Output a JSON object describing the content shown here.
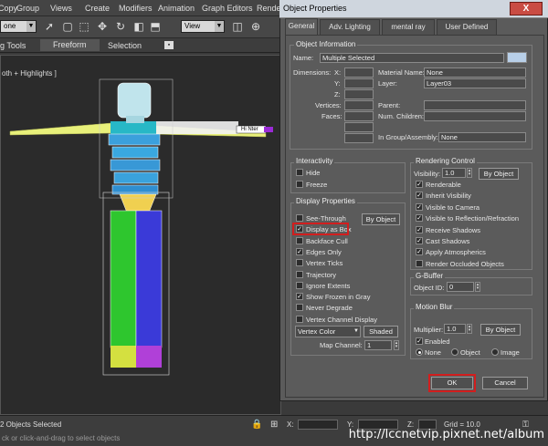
{
  "menubar": {
    "items": [
      "Copy",
      "Group",
      "Views",
      "Create",
      "Modifiers",
      "Animation",
      "Graph Editors",
      "Rende"
    ]
  },
  "toolbar": {
    "selection_filter": "one",
    "reference_coord": "View"
  },
  "ribbon": {
    "tabs": [
      "g Tools",
      "Freeform",
      "Selection"
    ]
  },
  "viewport": {
    "label": "oth + Highlights ]",
    "character_tag": "Hi Nter"
  },
  "status": {
    "selected": "2 Objects Selected",
    "hint": "ck or click-and-drag to select objects",
    "x_label": "X:",
    "y_label": "Y:",
    "z_label": "Z:",
    "grid": "Grid = 10.0"
  },
  "dialog": {
    "title": "Object Properties",
    "close": "X",
    "tabs": [
      "General",
      "Adv. Lighting",
      "mental ray",
      "User Defined"
    ],
    "object_info": {
      "title": "Object Information",
      "name_label": "Name:",
      "name_value": "Multiple Selected",
      "dimensions_label": "Dimensions:",
      "x_label": "X:",
      "y_label": "Y:",
      "z_label": "Z:",
      "vertices_label": "Vertices:",
      "faces_label": "Faces:",
      "material_label": "Material Name:",
      "material_value": "None",
      "layer_label": "Layer:",
      "layer_value": "Layer03",
      "parent_label": "Parent:",
      "children_label": "Num. Children:",
      "group_label": "In Group/Assembly:",
      "group_value": "None",
      "color_swatch": "#b8cfe8"
    },
    "interactivity": {
      "title": "Interactivity",
      "hide": "Hide",
      "freeze": "Freeze"
    },
    "display_props": {
      "title": "Display Properties",
      "by_object": "By Object",
      "items": [
        {
          "label": "See-Through",
          "checked": false
        },
        {
          "label": "Display as Box",
          "checked": true
        },
        {
          "label": "Backface Cull",
          "checked": false
        },
        {
          "label": "Edges Only",
          "checked": true
        },
        {
          "label": "Vertex Ticks",
          "checked": false
        },
        {
          "label": "Trajectory",
          "checked": false
        },
        {
          "label": "Ignore Extents",
          "checked": false
        },
        {
          "label": "Show Frozen in Gray",
          "checked": true
        },
        {
          "label": "Never Degrade",
          "checked": false
        },
        {
          "label": "Vertex Channel Display",
          "checked": false
        }
      ],
      "vertex_color": "Vertex Color",
      "shaded": "Shaded",
      "map_channel_label": "Map Channel:",
      "map_channel_value": "1"
    },
    "rendering": {
      "title": "Rendering Control",
      "visibility_label": "Visibility:",
      "visibility_value": "1.0",
      "by_object": "By Object",
      "items": [
        {
          "label": "Renderable",
          "checked": true
        },
        {
          "label": "Inherit Visibility",
          "checked": true
        },
        {
          "label": "Visible to Camera",
          "checked": true
        },
        {
          "label": "Visible to Reflection/Refraction",
          "checked": true
        },
        {
          "label": "Receive Shadows",
          "checked": true
        },
        {
          "label": "Cast Shadows",
          "checked": true
        },
        {
          "label": "Apply Atmospherics",
          "checked": true
        },
        {
          "label": "Render Occluded Objects",
          "checked": false
        }
      ]
    },
    "gbuffer": {
      "title": "G-Buffer",
      "object_id_label": "Object ID:",
      "object_id_value": "0"
    },
    "motion_blur": {
      "title": "Motion Blur",
      "multiplier_label": "Multiplier:",
      "multiplier_value": "1.0",
      "by_object": "By Object",
      "enabled": "Enabled",
      "none": "None",
      "object": "Object",
      "image": "Image"
    },
    "ok": "OK",
    "cancel": "Cancel"
  },
  "watermark": "http://lccnetvip.pixnet.net/album"
}
